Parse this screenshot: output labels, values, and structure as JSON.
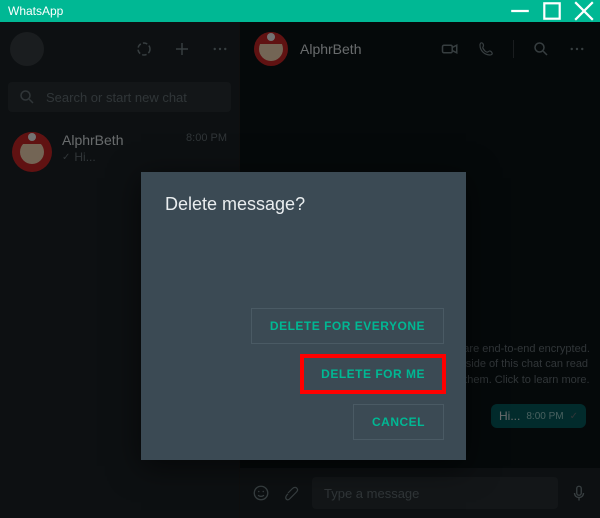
{
  "window": {
    "title": "WhatsApp"
  },
  "sidebar": {
    "search_placeholder": "Search or start new chat",
    "chats": [
      {
        "name": "AlphrBeth",
        "preview": "Hi...",
        "time": "8:00 PM"
      }
    ]
  },
  "conversation": {
    "contact_name": "AlphrBeth",
    "encryption_notice": "Messages are end-to-end encrypted. No one outside of this chat can read or listen to them. Click to learn more.",
    "outgoing_message": {
      "text": "Hi...",
      "time": "8:00 PM"
    },
    "composer_placeholder": "Type a message"
  },
  "dialog": {
    "title": "Delete message?",
    "delete_everyone": "DELETE FOR EVERYONE",
    "delete_me": "DELETE FOR ME",
    "cancel": "CANCEL"
  }
}
